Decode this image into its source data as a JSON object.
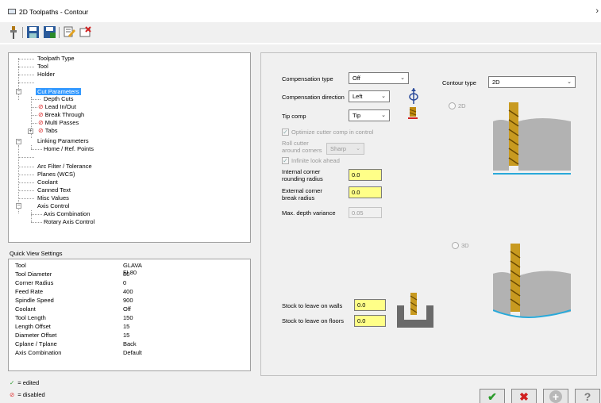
{
  "window": {
    "title": "2D Toolpaths - Contour",
    "close": "›"
  },
  "tree": {
    "toolpath_type": "Toolpath Type",
    "tool": "Tool",
    "holder": "Holder",
    "cut_parameters": "Cut Parameters",
    "depth_cuts": "Depth Cuts",
    "lead_in_out": "Lead In/Out",
    "break_through": "Break Through",
    "multi_passes": "Multi Passes",
    "tabs": "Tabs",
    "linking_parameters": "Linking Parameters",
    "home_ref_points": "Home / Ref. Points",
    "arc_filter": "Arc Filter / Tolerance",
    "planes": "Planes (WCS)",
    "coolant": "Coolant",
    "canned_text": "Canned Text",
    "misc_values": "Misc Values",
    "axis_control": "Axis Control",
    "axis_combination": "Axis Combination",
    "rotary_axis_control": "Rotary Axis Control",
    "disabled_symbol": "⊘",
    "expand_symbol": "+",
    "collapse_symbol": "−"
  },
  "quick_view": {
    "title": "Quick View Settings",
    "rows": [
      {
        "label": "Tool",
        "value": "GLAVA FI 80"
      },
      {
        "label": "Tool Diameter",
        "value": "80"
      },
      {
        "label": "Corner Radius",
        "value": "0"
      },
      {
        "label": "Feed Rate",
        "value": "400"
      },
      {
        "label": "Spindle Speed",
        "value": "900"
      },
      {
        "label": "Coolant",
        "value": "Off"
      },
      {
        "label": "Tool Length",
        "value": "150"
      },
      {
        "label": "Length Offset",
        "value": "15"
      },
      {
        "label": "Diameter Offset",
        "value": "15"
      },
      {
        "label": "Cplane / Tplane",
        "value": "Back"
      },
      {
        "label": "Axis Combination",
        "value": "Default"
      }
    ]
  },
  "legend": {
    "edited_symbol": "✓",
    "edited": "= edited",
    "disabled_symbol": "⊘",
    "disabled": "= disabled"
  },
  "params": {
    "compensation_type_label": "Compensation type",
    "compensation_type_value": "Off",
    "compensation_direction_label": "Compensation direction",
    "compensation_direction_value": "Left",
    "tip_comp_label": "Tip comp",
    "tip_comp_value": "Tip",
    "optimize_label": "Optimize cutter comp in control",
    "roll_cutter_label_1": "Roll cutter",
    "roll_cutter_label_2": "around corners",
    "roll_cutter_value": "Sharp",
    "infinite_label": "Infinite look ahead",
    "internal_corner_label_1": "Internal corner",
    "internal_corner_label_2": "rounding radius",
    "internal_corner_value": "0.0",
    "external_corner_label_1": "External corner",
    "external_corner_label_2": "break radius",
    "external_corner_value": "0.0",
    "max_depth_label": "Max. depth variance",
    "max_depth_value": "0.05",
    "contour_type_label": "Contour type",
    "contour_type_value": "2D",
    "radio_2d": "2D",
    "radio_3d": "3D",
    "stock_walls_label": "Stock to leave on walls",
    "stock_walls_value": "0.0",
    "stock_floors_label": "Stock to leave on floors",
    "stock_floors_value": "0.0",
    "dropdown_arrow": "⌄"
  },
  "buttons": {
    "ok": "✔",
    "cancel": "✖",
    "add": "+",
    "help": "?"
  },
  "colors": {
    "selected": "#3399ff",
    "field_yellow": "#ffff88",
    "disabled_red": "#e03030",
    "ok_green": "#2a9a2a",
    "cancel_red": "#d02020"
  }
}
